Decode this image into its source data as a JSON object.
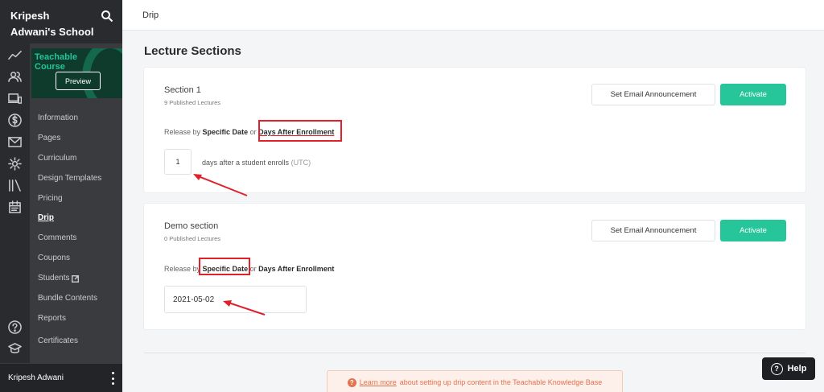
{
  "school": {
    "name": "Kripesh Adwani's School",
    "search_icon": "search-icon"
  },
  "rail": {
    "icons": [
      "analytics-icon",
      "users-icon",
      "devices-icon",
      "dollar-icon",
      "mail-icon",
      "gear-icon",
      "library-icon",
      "calendar-icon",
      "help-circle-icon",
      "graduation-cap-icon"
    ]
  },
  "course": {
    "thumb_title_1": "Teachable",
    "thumb_title_2": "Course",
    "preview_label": "Preview"
  },
  "menu": {
    "items": [
      {
        "label": "Information"
      },
      {
        "label": "Pages"
      },
      {
        "label": "Curriculum"
      },
      {
        "label": "Design Templates"
      },
      {
        "label": "Pricing"
      },
      {
        "label": "Drip"
      },
      {
        "label": "Comments"
      },
      {
        "label": "Coupons"
      },
      {
        "label": "Students"
      },
      {
        "label": "Bundle Contents"
      },
      {
        "label": "Reports"
      },
      {
        "label": "Certificates"
      }
    ],
    "active": "Drip"
  },
  "footer": {
    "user_name": "Kripesh Adwani"
  },
  "topbar": {
    "title": "Drip"
  },
  "page": {
    "heading": "Lecture Sections"
  },
  "sections": [
    {
      "title": "Section 1",
      "meta": "9 Published  Lectures",
      "email_label": "Set Email Announcement",
      "activate_label": "Activate",
      "release_prefix": "Release by",
      "option_date": "Specific Date",
      "or": "or",
      "option_days": "Days After Enrollment",
      "days_value": "1",
      "days_text": "days after a student enrolls",
      "days_tz": "(UTC)"
    },
    {
      "title": "Demo section",
      "meta": "0 Published  Lectures",
      "email_label": "Set Email Announcement",
      "activate_label": "Activate",
      "release_prefix": "Release by",
      "option_date": "Specific Date",
      "or": "or",
      "option_days": "Days After Enrollment",
      "date_value": "2021-05-02"
    }
  ],
  "kb_banner": {
    "link_text": "Learn more",
    "text": "about setting up drip content in the Teachable Knowledge Base"
  },
  "help": {
    "label": "Help"
  },
  "colors": {
    "accent": "#27c59a",
    "highlight": "#e0202a",
    "sidebar": "#2a2b2e"
  }
}
